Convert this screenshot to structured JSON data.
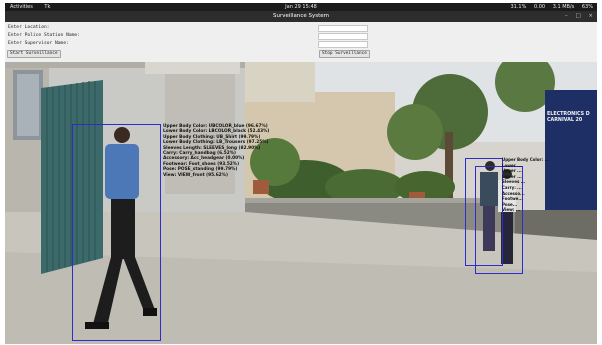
{
  "system_bar": {
    "activities": "Activities",
    "app": "Tk",
    "clock": "Jan 29 15:48",
    "indicators": [
      "31.1%",
      "0.00",
      "3.1 MB/s",
      "63%"
    ]
  },
  "window": {
    "title": "Surveillance System"
  },
  "form": {
    "fields": [
      {
        "label": "Enter Location:",
        "value": ""
      },
      {
        "label": "Enter Police Station Name:",
        "value": ""
      },
      {
        "label": "Enter Supervisor Name:",
        "value": ""
      }
    ],
    "start_button": "Start Surveillance",
    "stop_button": "Stop Surveillance"
  },
  "video": {
    "signboard": "ELECTRONICS D CARNIVAL 20",
    "box_color": "#2d2dcf",
    "detections": [
      {
        "attributes": [
          "Upper Body Color: UBCOLOR_blue (96.67%)",
          "Lower Body Color: LBCOLOR_black (52.43%)",
          "Upper Body Clothing: UB_Shirt (99.79%)",
          "Lower Body Clothing: LB_Trousers (97.25%)",
          "Sleeves Length: SLEEVES_long (82.90%)",
          "Carry: Carry_handbag (6.52%)",
          "Accessory: Acc_headgear (0.00%)",
          "Footwear: Foot_shoes (93.52%)",
          "Pose: POSE_standing (99.79%)",
          "View: VIEW_front (95.62%)"
        ]
      },
      {
        "attributes": [
          "Upper Body Color: ...",
          "Lower ...",
          "Upper ...",
          "Lower ...",
          "Sleeves ...",
          "Carry: ...",
          "Accesso...",
          "Footwe...",
          "Pose...",
          "View: ..."
        ]
      }
    ]
  }
}
